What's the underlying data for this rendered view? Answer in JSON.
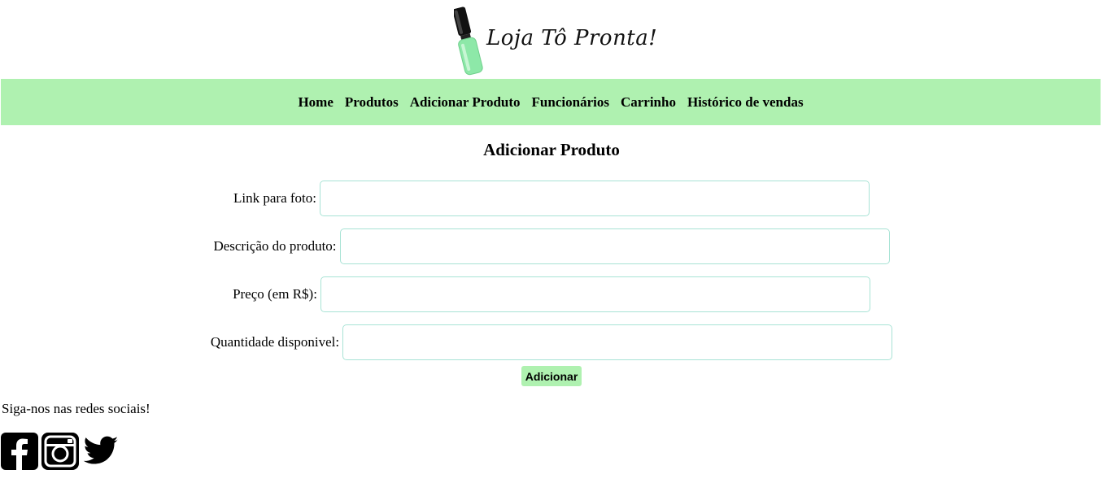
{
  "header": {
    "logo_text": "Loja Tô Pronta!",
    "logo_bottle_color": "#8de8a8"
  },
  "nav": {
    "items": [
      {
        "label": "Home"
      },
      {
        "label": "Produtos"
      },
      {
        "label": "Adicionar Produto"
      },
      {
        "label": "Funcionários"
      },
      {
        "label": "Carrinho"
      },
      {
        "label": "Histórico de vendas"
      }
    ],
    "background": "#aff1b0"
  },
  "form": {
    "title": "Adicionar Produto",
    "fields": [
      {
        "label": "Link para foto:",
        "value": ""
      },
      {
        "label": "Descrição do produto:",
        "value": ""
      },
      {
        "label": "Preço (em R$):",
        "value": ""
      },
      {
        "label": "Quantidade disponivel:",
        "value": ""
      }
    ],
    "submit_label": "Adicionar"
  },
  "footer": {
    "social_text": "Siga-nos nas redes sociais!",
    "icons": [
      "facebook-icon",
      "instagram-icon",
      "twitter-icon"
    ]
  }
}
